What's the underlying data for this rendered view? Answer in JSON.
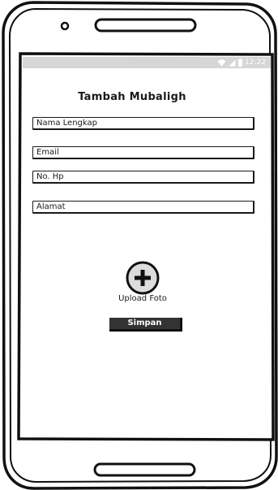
{
  "status_bar": {
    "time": "12:22",
    "wifi_icon": "wifi-icon",
    "signal_icon": "signal-icon",
    "battery_icon": "battery-icon"
  },
  "form": {
    "title": "Tambah Mubaligh",
    "fields": [
      {
        "label": "Nama Lengkap"
      },
      {
        "label": "Email"
      },
      {
        "label": "No. Hp"
      },
      {
        "label": "Alamat"
      }
    ],
    "upload": {
      "icon": "plus-icon",
      "label": "Upload Foto"
    },
    "save_button": "Simpan"
  },
  "colors": {
    "status_bar": "#d6d6d6",
    "button": "#333333",
    "outline": "#1a1a1a"
  }
}
